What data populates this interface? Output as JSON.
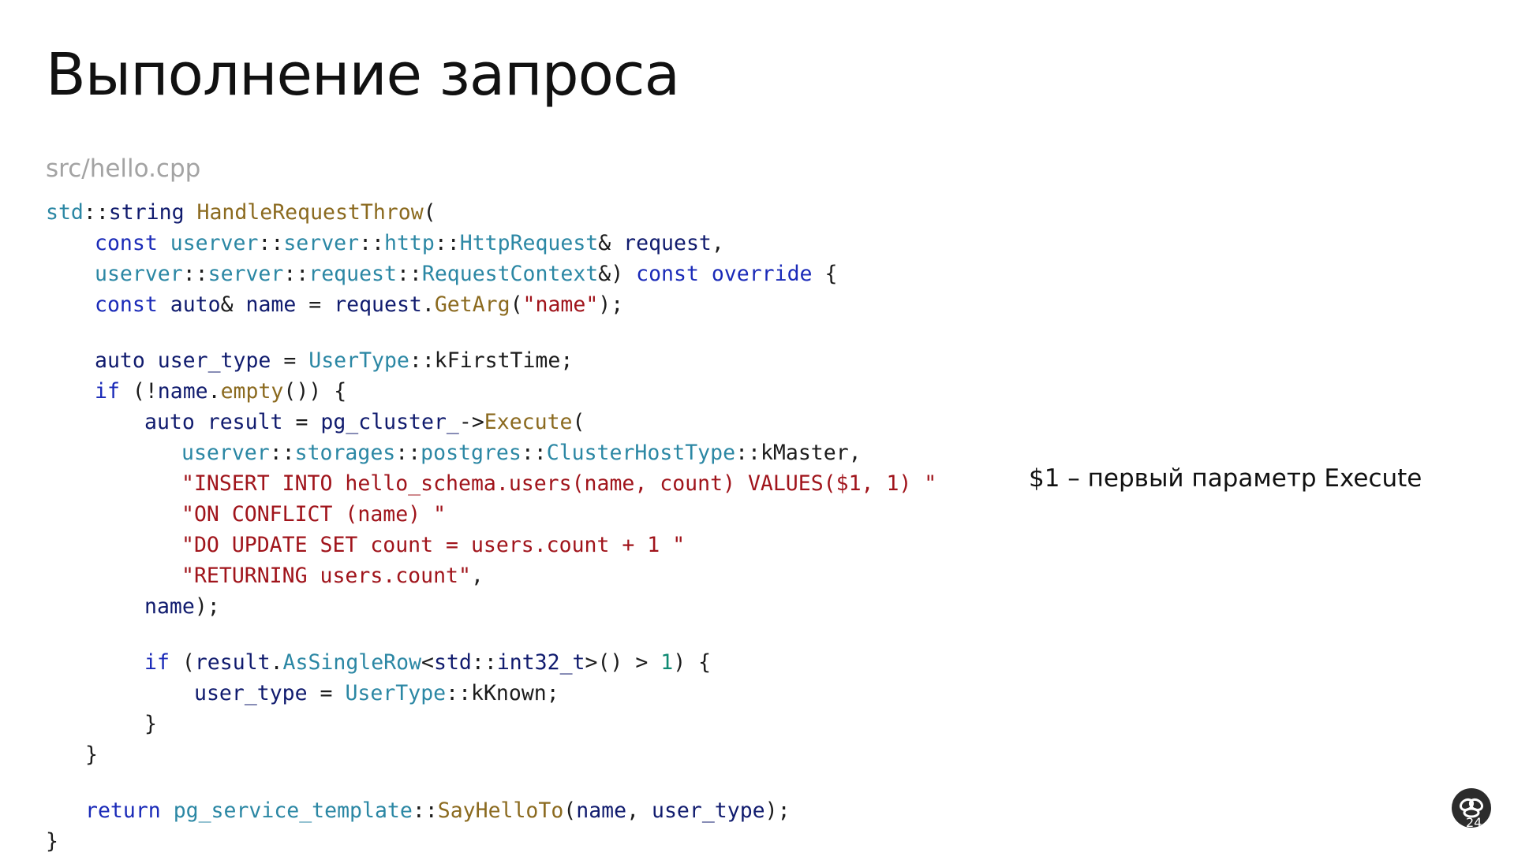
{
  "slide": {
    "title": "Выполнение запроса",
    "file": "src/hello.cpp",
    "note": "$1 – первый параметр Execute",
    "page_number": "24"
  },
  "code": {
    "lines": [
      [
        [
          "ns",
          "std"
        ],
        [
          "plain",
          "::"
        ],
        [
          "var",
          "string "
        ],
        [
          "fn",
          "HandleRequestThrow"
        ],
        [
          "plain",
          "("
        ]
      ],
      [
        [
          "kw",
          "const "
        ],
        [
          "ns",
          "userver"
        ],
        [
          "plain",
          "::"
        ],
        [
          "ns",
          "server"
        ],
        [
          "plain",
          "::"
        ],
        [
          "ns",
          "http"
        ],
        [
          "plain",
          "::"
        ],
        [
          "ns",
          "HttpRequest"
        ],
        [
          "plain",
          "& "
        ],
        [
          "var",
          "request"
        ],
        [
          "plain",
          ","
        ]
      ],
      [
        [
          "ns",
          "userver"
        ],
        [
          "plain",
          "::"
        ],
        [
          "ns",
          "server"
        ],
        [
          "plain",
          "::"
        ],
        [
          "ns",
          "request"
        ],
        [
          "plain",
          "::"
        ],
        [
          "ns",
          "RequestContext"
        ],
        [
          "plain",
          "&) "
        ],
        [
          "kw",
          "const override "
        ],
        [
          "plain",
          "{"
        ]
      ],
      [
        [
          "kw",
          "const "
        ],
        [
          "var",
          "auto"
        ],
        [
          "plain",
          "& "
        ],
        [
          "var",
          "name "
        ],
        [
          "plain",
          "= "
        ],
        [
          "var",
          "request"
        ],
        [
          "plain",
          "."
        ],
        [
          "fn",
          "GetArg"
        ],
        [
          "plain",
          "("
        ],
        [
          "str",
          "\"name\""
        ],
        [
          "plain",
          ");"
        ]
      ],
      [
        [
          "var",
          "auto user_type "
        ],
        [
          "plain",
          "= "
        ],
        [
          "ns",
          "UserType"
        ],
        [
          "plain",
          "::kFirstTime;"
        ]
      ],
      [
        [
          "kw",
          "if "
        ],
        [
          "plain",
          "(!"
        ],
        [
          "var",
          "name"
        ],
        [
          "plain",
          "."
        ],
        [
          "fn",
          "empty"
        ],
        [
          "plain",
          "()) {"
        ]
      ],
      [
        [
          "var",
          "auto result "
        ],
        [
          "plain",
          "= "
        ],
        [
          "var",
          "pg_cluster_"
        ],
        [
          "plain",
          "->"
        ],
        [
          "fn",
          "Execute"
        ],
        [
          "plain",
          "("
        ]
      ],
      [
        [
          "ns",
          "userver"
        ],
        [
          "plain",
          "::"
        ],
        [
          "ns",
          "storages"
        ],
        [
          "plain",
          "::"
        ],
        [
          "ns",
          "postgres"
        ],
        [
          "plain",
          "::"
        ],
        [
          "ns",
          "ClusterHostType"
        ],
        [
          "plain",
          "::kMaster,"
        ]
      ],
      [
        [
          "str",
          "\"INSERT INTO hello_schema.users(name, count) VALUES($1, 1) \""
        ]
      ],
      [
        [
          "str",
          "\"ON CONFLICT (name) \""
        ]
      ],
      [
        [
          "str",
          "\"DO UPDATE SET count = users.count + 1 \""
        ]
      ],
      [
        [
          "str",
          "\"RETURNING users.count\""
        ],
        [
          "plain",
          ","
        ]
      ],
      [
        [
          "var",
          "name"
        ],
        [
          "plain",
          ");"
        ]
      ],
      [
        [
          "kw",
          "if "
        ],
        [
          "plain",
          "("
        ],
        [
          "var",
          "result"
        ],
        [
          "plain",
          "."
        ],
        [
          "ns",
          "AsSingleRow"
        ],
        [
          "plain",
          "<"
        ],
        [
          "var",
          "std"
        ],
        [
          "plain",
          "::"
        ],
        [
          "var",
          "int32_t"
        ],
        [
          "plain",
          ">() > "
        ],
        [
          "num",
          "1"
        ],
        [
          "plain",
          ") {"
        ]
      ],
      [
        [
          "var",
          "user_type "
        ],
        [
          "plain",
          "= "
        ],
        [
          "ns",
          "UserType"
        ],
        [
          "plain",
          "::kKnown;"
        ]
      ],
      [
        [
          "plain",
          "}"
        ]
      ],
      [
        [
          "plain",
          "}"
        ]
      ],
      [
        [
          "kw",
          "return "
        ],
        [
          "ns",
          "pg_service_template"
        ],
        [
          "plain",
          "::"
        ],
        [
          "fn",
          "SayHelloTo"
        ],
        [
          "plain",
          "("
        ],
        [
          "var",
          "name"
        ],
        [
          "plain",
          ", "
        ],
        [
          "var",
          "user_type"
        ],
        [
          "plain",
          ");"
        ]
      ],
      [
        [
          "plain",
          "}"
        ]
      ]
    ]
  },
  "icons": {
    "logo": "userver-logo-icon"
  }
}
